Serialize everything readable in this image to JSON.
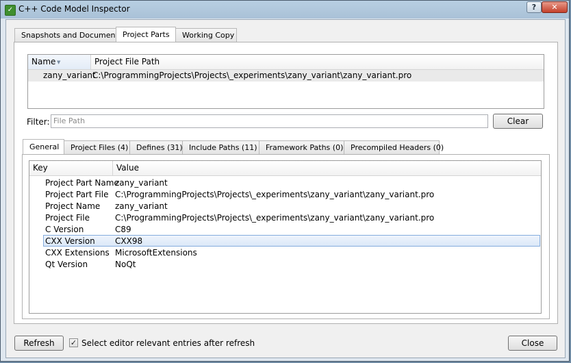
{
  "window": {
    "title": "C++ Code Model Inspector",
    "app_icon_glyph": "✓",
    "help_glyph": "?",
    "close_glyph": "✕"
  },
  "top_tabs": [
    {
      "label": "Snapshots and Documents",
      "active": false
    },
    {
      "label": "Project Parts",
      "active": true
    },
    {
      "label": "Working Copy",
      "active": false
    }
  ],
  "parts_table": {
    "headers": [
      "Name",
      "Project File Path"
    ],
    "rows": [
      {
        "name": "zany_variant",
        "path": "C:\\ProgrammingProjects\\Projects\\_experiments\\zany_variant\\zany_variant.pro"
      }
    ]
  },
  "filter": {
    "label": "Filter:",
    "placeholder": "File Path",
    "value": "",
    "clear_label": "Clear"
  },
  "detail_tabs": [
    {
      "label": "General",
      "active": true
    },
    {
      "label": "Project Files (4)",
      "active": false
    },
    {
      "label": "Defines (31)",
      "active": false
    },
    {
      "label": "Include Paths (11)",
      "active": false
    },
    {
      "label": "Framework Paths (0)",
      "active": false
    },
    {
      "label": "Precompiled Headers (0)",
      "active": false
    }
  ],
  "general_table": {
    "headers": [
      "Key",
      "Value"
    ],
    "rows": [
      {
        "key": "Project Part Name",
        "value": "zany_variant"
      },
      {
        "key": "Project Part File",
        "value": "C:\\ProgrammingProjects\\Projects\\_experiments\\zany_variant\\zany_variant.pro"
      },
      {
        "key": "Project Name",
        "value": "zany_variant"
      },
      {
        "key": "Project File",
        "value": "C:\\ProgrammingProjects\\Projects\\_experiments\\zany_variant\\zany_variant.pro"
      },
      {
        "key": "C Version",
        "value": "C89"
      },
      {
        "key": "CXX Version",
        "value": "CXX98",
        "selected": true
      },
      {
        "key": "CXX Extensions",
        "value": "MicrosoftExtensions"
      },
      {
        "key": "Qt Version",
        "value": "NoQt"
      }
    ]
  },
  "footer": {
    "refresh_label": "Refresh",
    "checkbox_checked": true,
    "checkbox_glyph": "✓",
    "checkbox_label": "Select editor relevant entries after refresh",
    "close_label": "Close"
  }
}
